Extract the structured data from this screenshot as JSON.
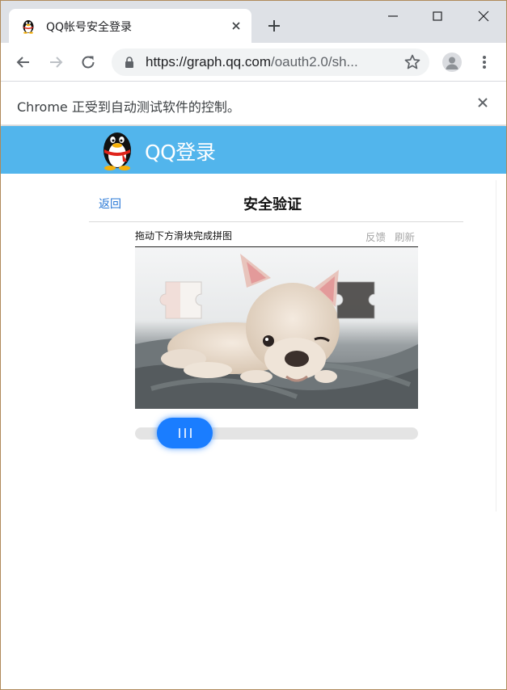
{
  "browser": {
    "tab": {
      "title": "QQ帐号安全登录",
      "favicon": "qq-penguin-icon",
      "close_icon": "close-icon"
    },
    "new_tab_icon": "plus-icon",
    "window_controls": [
      "minimize-icon",
      "maximize-icon",
      "close-icon"
    ],
    "toolbar": {
      "back_icon": "arrow-left-icon",
      "forward_icon": "arrow-right-icon",
      "reload_icon": "reload-icon",
      "url_host": "https://graph.qq.com",
      "url_path": "/oauth2.0/sh...",
      "lock_icon": "lock-icon",
      "star_icon": "star-icon",
      "profile_icon": "avatar-icon",
      "menu_icon": "kebab-menu-icon"
    },
    "infobar": {
      "text": "Chrome 正受到自动测试软件的控制。",
      "close_icon": "close-icon"
    }
  },
  "page": {
    "header": {
      "logo": "qq-penguin-logo",
      "title": "QQ登录",
      "background": "#52b5ec"
    },
    "verify": {
      "back_label": "返回",
      "title": "安全验证",
      "instruction": "拖动下方滑块完成拼图",
      "feedback_label": "反馈",
      "refresh_label": "刷新",
      "image": "puppy-photo-with-puzzle-gap",
      "slider": {
        "handle_icon": "grip-lines-icon",
        "handle_color": "#1a7dff",
        "track_color": "#e4e4e4"
      }
    }
  },
  "colors": {
    "link": "#2777d6",
    "accent": "#1a7dff"
  }
}
